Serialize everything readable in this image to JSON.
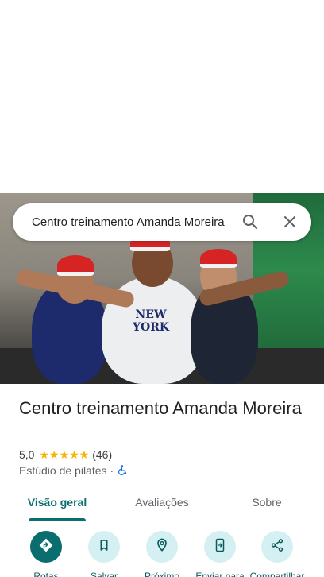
{
  "search": {
    "query": "Centro treinamento Amanda Moreira"
  },
  "place": {
    "title": "Centro treinamento Amanda Moreira",
    "rating": "5,0",
    "stars": "★★★★★",
    "review_count": "(46)",
    "category": "Estúdio de pilates",
    "separator": "·"
  },
  "tabs": [
    {
      "label": "Visão geral"
    },
    {
      "label": "Avaliações"
    },
    {
      "label": "Sobre"
    }
  ],
  "actions": [
    {
      "label": "Rotas",
      "icon": "directions-icon"
    },
    {
      "label": "Salvar",
      "icon": "bookmark-icon"
    },
    {
      "label": "Próximo",
      "icon": "nearby-icon"
    },
    {
      "label": "Enviar para",
      "icon": "send-to-phone-icon"
    },
    {
      "label": "Compartilhar",
      "icon": "share-icon"
    }
  ],
  "colors": {
    "accent": "#0b6e6e",
    "accent_light": "#d5f0f2",
    "star": "#f5b400"
  }
}
